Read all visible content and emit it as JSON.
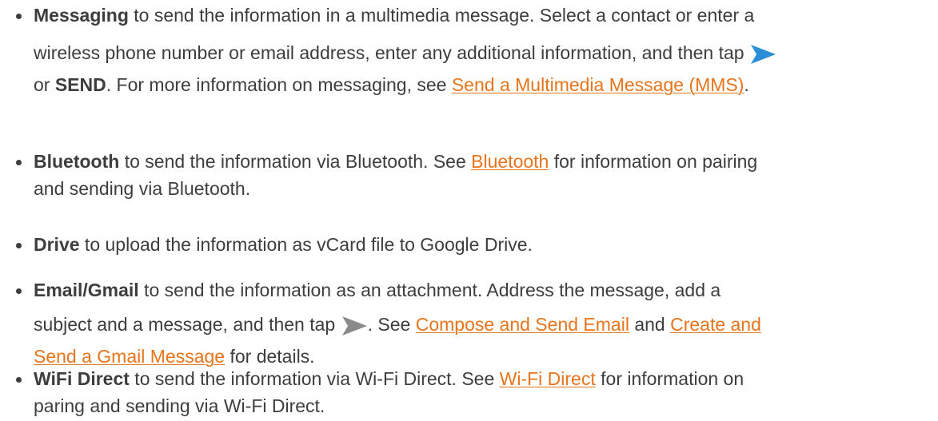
{
  "colors": {
    "text": "#3d3d3d",
    "link": "#e8741b",
    "send_icon_blue": "#2a8fd8",
    "send_icon_gray": "#8a8a8a"
  },
  "items": [
    {
      "term": "Messaging",
      "text_1": " to send the information in a multimedia message. Select a contact or enter a",
      "text_2": "wireless phone number or email address, enter any additional information, and then tap",
      "text_3a": " or ",
      "term_2": "SEND",
      "text_3b": ". For more information on messaging, see ",
      "link": "Send a Multimedia Message (MMS)",
      "text_3c": ".",
      "icon": "send-arrow-blue-icon"
    },
    {
      "term": "Bluetooth",
      "text_1": " to send the information via Bluetooth. See ",
      "link": "Bluetooth",
      "text_2": " for information on pairing",
      "text_3": "and sending via Bluetooth."
    },
    {
      "term": "Drive",
      "text_1": " to upload the information as vCard file to Google Drive."
    },
    {
      "term": "Email/Gmail",
      "text_1": " to send the information as an attachment. Address the message, add a",
      "text_2": "subject and a message, and then tap ",
      "text_2b": ". See ",
      "link_1": "Compose and Send Email",
      "text_2c": " and ",
      "link_2a": "Create and",
      "link_2b": "Send a Gmail Message",
      "text_3": " for details.",
      "icon": "send-arrow-gray-icon"
    },
    {
      "term": "WiFi Direct",
      "text_1": " to send the information via Wi-Fi Direct. See ",
      "link": "Wi-Fi Direct",
      "text_2": " for information on",
      "text_3": "paring and sending via Wi-Fi Direct."
    }
  ]
}
